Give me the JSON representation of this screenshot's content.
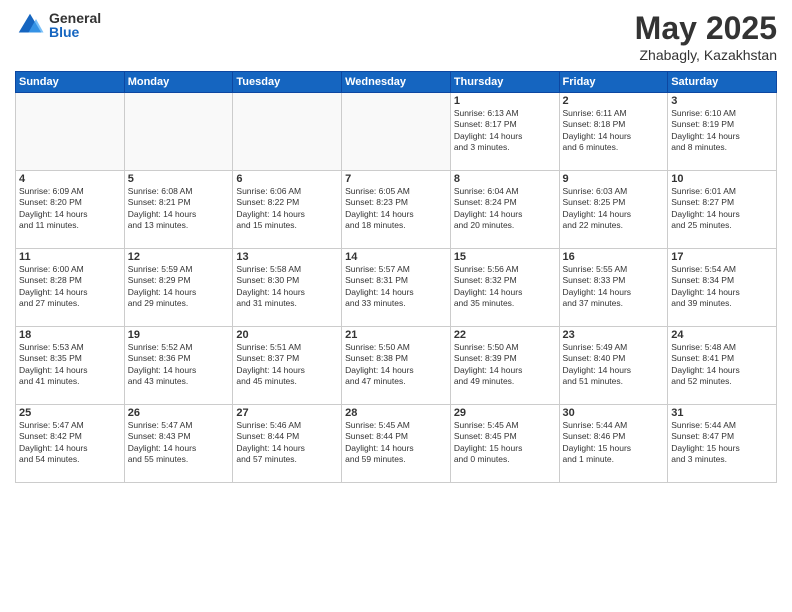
{
  "logo": {
    "general": "General",
    "blue": "Blue"
  },
  "title": {
    "month": "May 2025",
    "location": "Zhabagly, Kazakhstan"
  },
  "weekdays": [
    "Sunday",
    "Monday",
    "Tuesday",
    "Wednesday",
    "Thursday",
    "Friday",
    "Saturday"
  ],
  "weeks": [
    [
      {
        "day": "",
        "info": ""
      },
      {
        "day": "",
        "info": ""
      },
      {
        "day": "",
        "info": ""
      },
      {
        "day": "",
        "info": ""
      },
      {
        "day": "1",
        "info": "Sunrise: 6:13 AM\nSunset: 8:17 PM\nDaylight: 14 hours\nand 3 minutes."
      },
      {
        "day": "2",
        "info": "Sunrise: 6:11 AM\nSunset: 8:18 PM\nDaylight: 14 hours\nand 6 minutes."
      },
      {
        "day": "3",
        "info": "Sunrise: 6:10 AM\nSunset: 8:19 PM\nDaylight: 14 hours\nand 8 minutes."
      }
    ],
    [
      {
        "day": "4",
        "info": "Sunrise: 6:09 AM\nSunset: 8:20 PM\nDaylight: 14 hours\nand 11 minutes."
      },
      {
        "day": "5",
        "info": "Sunrise: 6:08 AM\nSunset: 8:21 PM\nDaylight: 14 hours\nand 13 minutes."
      },
      {
        "day": "6",
        "info": "Sunrise: 6:06 AM\nSunset: 8:22 PM\nDaylight: 14 hours\nand 15 minutes."
      },
      {
        "day": "7",
        "info": "Sunrise: 6:05 AM\nSunset: 8:23 PM\nDaylight: 14 hours\nand 18 minutes."
      },
      {
        "day": "8",
        "info": "Sunrise: 6:04 AM\nSunset: 8:24 PM\nDaylight: 14 hours\nand 20 minutes."
      },
      {
        "day": "9",
        "info": "Sunrise: 6:03 AM\nSunset: 8:25 PM\nDaylight: 14 hours\nand 22 minutes."
      },
      {
        "day": "10",
        "info": "Sunrise: 6:01 AM\nSunset: 8:27 PM\nDaylight: 14 hours\nand 25 minutes."
      }
    ],
    [
      {
        "day": "11",
        "info": "Sunrise: 6:00 AM\nSunset: 8:28 PM\nDaylight: 14 hours\nand 27 minutes."
      },
      {
        "day": "12",
        "info": "Sunrise: 5:59 AM\nSunset: 8:29 PM\nDaylight: 14 hours\nand 29 minutes."
      },
      {
        "day": "13",
        "info": "Sunrise: 5:58 AM\nSunset: 8:30 PM\nDaylight: 14 hours\nand 31 minutes."
      },
      {
        "day": "14",
        "info": "Sunrise: 5:57 AM\nSunset: 8:31 PM\nDaylight: 14 hours\nand 33 minutes."
      },
      {
        "day": "15",
        "info": "Sunrise: 5:56 AM\nSunset: 8:32 PM\nDaylight: 14 hours\nand 35 minutes."
      },
      {
        "day": "16",
        "info": "Sunrise: 5:55 AM\nSunset: 8:33 PM\nDaylight: 14 hours\nand 37 minutes."
      },
      {
        "day": "17",
        "info": "Sunrise: 5:54 AM\nSunset: 8:34 PM\nDaylight: 14 hours\nand 39 minutes."
      }
    ],
    [
      {
        "day": "18",
        "info": "Sunrise: 5:53 AM\nSunset: 8:35 PM\nDaylight: 14 hours\nand 41 minutes."
      },
      {
        "day": "19",
        "info": "Sunrise: 5:52 AM\nSunset: 8:36 PM\nDaylight: 14 hours\nand 43 minutes."
      },
      {
        "day": "20",
        "info": "Sunrise: 5:51 AM\nSunset: 8:37 PM\nDaylight: 14 hours\nand 45 minutes."
      },
      {
        "day": "21",
        "info": "Sunrise: 5:50 AM\nSunset: 8:38 PM\nDaylight: 14 hours\nand 47 minutes."
      },
      {
        "day": "22",
        "info": "Sunrise: 5:50 AM\nSunset: 8:39 PM\nDaylight: 14 hours\nand 49 minutes."
      },
      {
        "day": "23",
        "info": "Sunrise: 5:49 AM\nSunset: 8:40 PM\nDaylight: 14 hours\nand 51 minutes."
      },
      {
        "day": "24",
        "info": "Sunrise: 5:48 AM\nSunset: 8:41 PM\nDaylight: 14 hours\nand 52 minutes."
      }
    ],
    [
      {
        "day": "25",
        "info": "Sunrise: 5:47 AM\nSunset: 8:42 PM\nDaylight: 14 hours\nand 54 minutes."
      },
      {
        "day": "26",
        "info": "Sunrise: 5:47 AM\nSunset: 8:43 PM\nDaylight: 14 hours\nand 55 minutes."
      },
      {
        "day": "27",
        "info": "Sunrise: 5:46 AM\nSunset: 8:44 PM\nDaylight: 14 hours\nand 57 minutes."
      },
      {
        "day": "28",
        "info": "Sunrise: 5:45 AM\nSunset: 8:44 PM\nDaylight: 14 hours\nand 59 minutes."
      },
      {
        "day": "29",
        "info": "Sunrise: 5:45 AM\nSunset: 8:45 PM\nDaylight: 15 hours\nand 0 minutes."
      },
      {
        "day": "30",
        "info": "Sunrise: 5:44 AM\nSunset: 8:46 PM\nDaylight: 15 hours\nand 1 minute."
      },
      {
        "day": "31",
        "info": "Sunrise: 5:44 AM\nSunset: 8:47 PM\nDaylight: 15 hours\nand 3 minutes."
      }
    ]
  ]
}
